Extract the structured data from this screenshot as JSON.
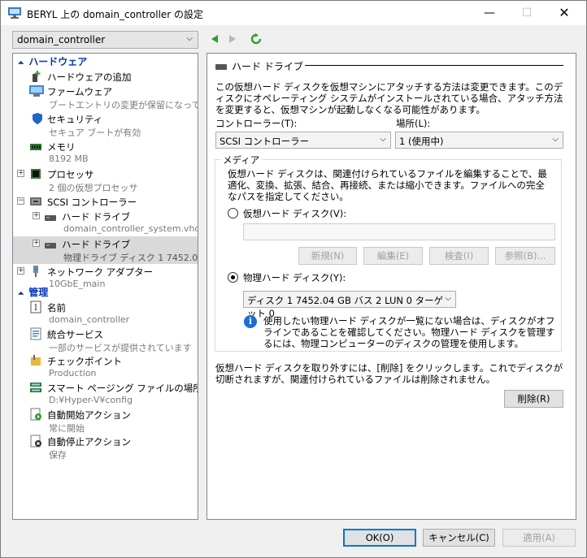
{
  "window": {
    "title": "BERYL 上の domain_controller の設定",
    "min_glyph": "—",
    "max_glyph": "☐",
    "close_glyph": "✕"
  },
  "vm_selector": {
    "value": "domain_controller"
  },
  "nav": {
    "back_icon": "back-arrow-icon",
    "forward_icon": "forward-arrow-icon",
    "refresh_icon": "refresh-icon"
  },
  "sidebar": {
    "hardware_header": "ハードウェア",
    "management_header": "管理",
    "items": [
      {
        "label": "ハードウェアの追加",
        "sub": ""
      },
      {
        "label": "ファームウェア",
        "sub": "ブートエントリの変更が保留になって..."
      },
      {
        "label": "セキュリティ",
        "sub": "セキュア ブートが有効"
      },
      {
        "label": "メモリ",
        "sub": "8192 MB"
      },
      {
        "label": "プロセッサ",
        "sub": "2 個の仮想プロセッサ"
      },
      {
        "label": "SCSI コントローラー",
        "sub": ""
      },
      {
        "label": "ハード ドライブ",
        "sub": "domain_controller_system.vhdx"
      },
      {
        "label": "ハード ドライブ",
        "sub": "物理ドライブ ディスク 1 7452.04..."
      },
      {
        "label": "ネットワーク アダプター",
        "sub": "10GbE_main"
      }
    ],
    "mgmt_items": [
      {
        "label": "名前",
        "sub": "domain_controller"
      },
      {
        "label": "統合サービス",
        "sub": "一部のサービスが提供されています"
      },
      {
        "label": "チェックポイント",
        "sub": "Production"
      },
      {
        "label": "スマート ページング ファイルの場所",
        "sub": "D:¥Hyper-V¥config"
      },
      {
        "label": "自動開始アクション",
        "sub": "常に開始"
      },
      {
        "label": "自動停止アクション",
        "sub": "保存"
      }
    ]
  },
  "panel": {
    "title": "ハード ドライブ",
    "description": "この仮想ハード ディスクを仮想マシンにアタッチする方法は変更できます。このディスクにオペレーティング システムがインストールされている場合、アタッチ方法を変更すると、仮想マシンが起動しなくなる可能性があります。",
    "controller_label": "コントローラー(T):",
    "controller_value": "SCSI コントローラー",
    "location_label": "場所(L):",
    "location_value": "1 (使用中)",
    "media_label": "メディア",
    "media_desc": "仮想ハード ディスクは、関連付けられているファイルを編集することで、最適化、変換、拡張、結合、再接続、または縮小できます。ファイルへの完全なパスを指定してください。",
    "vhd_radio": "仮想ハード ディスク(V):",
    "vhd_path": "",
    "btn_new": "新規(N)",
    "btn_edit": "編集(E)",
    "btn_inspect": "検査(I)",
    "btn_browse": "参照(B)...",
    "phys_radio": "物理ハード ディスク(Y):",
    "phys_value": "ディスク 1 7452.04 GB バス 2 LUN 0 ターゲット 0",
    "info_text": "使用したい物理ハード ディスクが一覧にない場合は、ディスクがオフラインであることを確認してください。物理ハード ディスクを管理するには、物理コンピューターのディスクの管理を使用します。",
    "remove_text": "仮想ハード ディスクを取り外すには、[削除] をクリックします。これでディスクが切断されますが、関連付けられているファイルは削除されません。",
    "btn_remove": "削除(R)"
  },
  "footer": {
    "ok": "OK(O)",
    "cancel": "キャンセル(C)",
    "apply": "適用(A)"
  }
}
